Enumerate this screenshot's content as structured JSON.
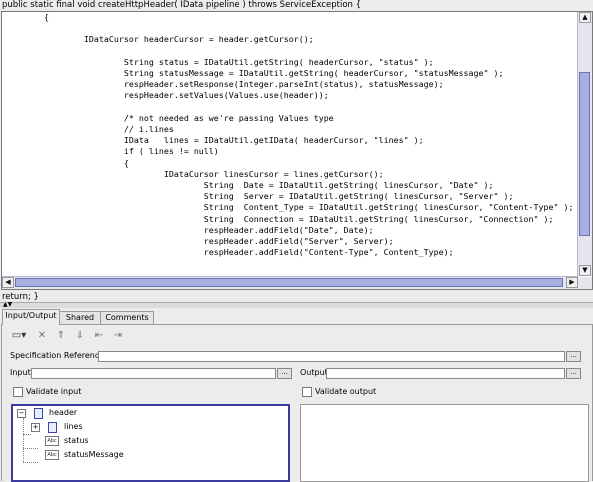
{
  "signature": "public static final void createHttpHeader( IData pipeline ) throws ServiceException {",
  "code_lines": [
    "        {",
    "",
    "                IDataCursor headerCursor = header.getCursor();",
    "",
    "                        String status = IDataUtil.getString( headerCursor, \"status\" );",
    "                        String statusMessage = IDataUtil.getString( headerCursor, \"statusMessage\" );",
    "                        respHeader.setResponse(Integer.parseInt(status), statusMessage);",
    "                        respHeader.setValues(Values.use(header));",
    "",
    "                        /* not needed as we're passing Values type",
    "                        // i.lines",
    "                        IData   lines = IDataUtil.getIData( headerCursor, \"lines\" );",
    "                        if ( lines != null)",
    "                        {",
    "                                IDataCursor linesCursor = lines.getCursor();",
    "                                        String  Date = IDataUtil.getString( linesCursor, \"Date\" );",
    "                                        String  Server = IDataUtil.getString( linesCursor, \"Server\" );",
    "                                        String  Content_Type = IDataUtil.getString( linesCursor, \"Content-Type\" );",
    "                                        String  Connection = IDataUtil.getString( linesCursor, \"Connection\" );",
    "                                        respHeader.addField(\"Date\", Date);",
    "                                        respHeader.addField(\"Server\", Server);",
    "                                        respHeader.addField(\"Content-Type\", Content_Type);"
  ],
  "footer_code": "return; }",
  "tabs": [
    {
      "label": "Input/Output",
      "active": true
    },
    {
      "label": "Shared",
      "active": false
    },
    {
      "label": "Comments",
      "active": false
    }
  ],
  "toolbar_icons": [
    "new-field-icon",
    "delete-icon",
    "move-up-icon",
    "move-down-icon",
    "shift-left-icon",
    "shift-right-icon"
  ],
  "spec_ref": {
    "label": "Specification Reference",
    "value": "",
    "browse": "..."
  },
  "input": {
    "label": "Input",
    "value": "",
    "browse": "..."
  },
  "output": {
    "label": "Output",
    "value": "",
    "browse": "..."
  },
  "validate_input": {
    "label": "Validate input",
    "checked": false
  },
  "validate_output": {
    "label": "Validate output",
    "checked": false
  },
  "input_tree": [
    {
      "label": "header",
      "type": "document",
      "level": 0,
      "expanded": true
    },
    {
      "label": "lines",
      "type": "document",
      "level": 1,
      "expanded": false
    },
    {
      "label": "status",
      "type": "string",
      "level": 1
    },
    {
      "label": "statusMessage",
      "type": "string",
      "level": 1
    }
  ],
  "string_icon_text": "Abc",
  "colors": {
    "selection_border": "#3a3aa0",
    "scroll_thumb": "#a8aee0"
  }
}
